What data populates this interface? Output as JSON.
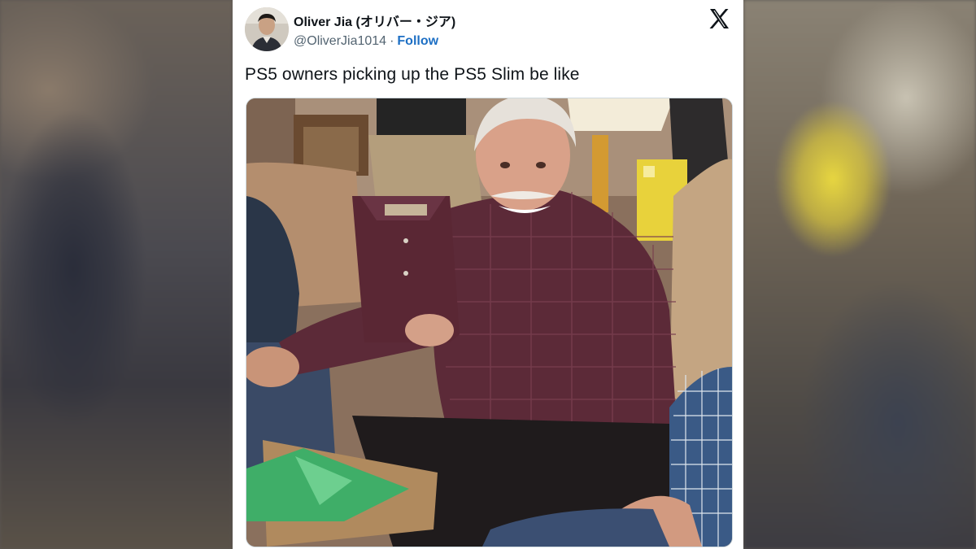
{
  "tweet": {
    "author_name": "Oliver Jia (オリバー・ジア)",
    "handle": "@OliverJia1014",
    "separator": "·",
    "follow_label": "Follow",
    "text": "PS5 owners picking up the PS5 Slim be like",
    "platform_icon": "x-logo-icon",
    "media_description_icon": "photo"
  },
  "colors": {
    "text_primary": "#0f1419",
    "text_secondary": "#536471",
    "follow_link": "#1d6fc4",
    "card_background": "#ffffff"
  }
}
